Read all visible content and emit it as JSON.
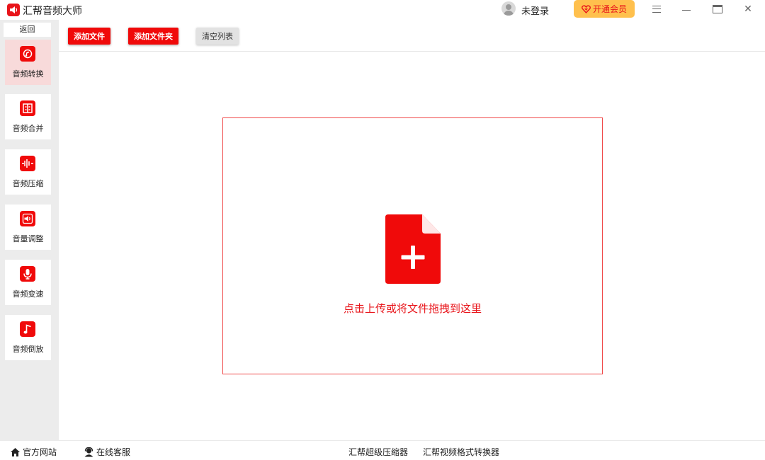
{
  "titlebar": {
    "app_title": "汇帮音频大师",
    "login_text": "未登录",
    "vip_label": "开通会员",
    "icons": [
      "speaker-icon",
      "user-avatar-icon",
      "heart-diamond-icon",
      "menu-icon",
      "minimize-icon",
      "maximize-icon",
      "close-icon"
    ]
  },
  "sidebar": {
    "back_label": "返回",
    "items": [
      {
        "label": "音频转换",
        "icon": "audio-convert-icon",
        "active": true
      },
      {
        "label": "音频合并",
        "icon": "audio-merge-icon",
        "active": false
      },
      {
        "label": "音频压缩",
        "icon": "audio-compress-icon",
        "active": false
      },
      {
        "label": "音量调整",
        "icon": "volume-icon",
        "active": false
      },
      {
        "label": "音频变速",
        "icon": "microphone-icon",
        "active": false
      },
      {
        "label": "音频倒放",
        "icon": "music-note-icon",
        "active": false
      }
    ]
  },
  "toolbar": {
    "add_file": "添加文件",
    "add_folder": "添加文件夹",
    "clear_list": "清空列表"
  },
  "dropzone": {
    "hint": "点击上传或将文件拖拽到这里",
    "icon": "file-plus-icon"
  },
  "footer": {
    "website": "官方网站",
    "support": "在线客服",
    "compressor": "汇帮超级压缩器",
    "video_converter": "汇帮视频格式转换器"
  },
  "colors": {
    "accent": "#f00a0a",
    "vip": "#ffc04d",
    "sidebar_bg": "#ececec",
    "active_item": "#f8dada"
  }
}
